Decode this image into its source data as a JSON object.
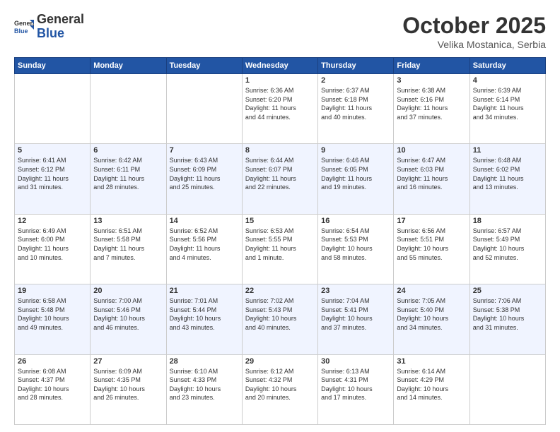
{
  "header": {
    "logo_general": "General",
    "logo_blue": "Blue",
    "month": "October 2025",
    "location": "Velika Mostanica, Serbia"
  },
  "weekdays": [
    "Sunday",
    "Monday",
    "Tuesday",
    "Wednesday",
    "Thursday",
    "Friday",
    "Saturday"
  ],
  "weeks": [
    [
      {
        "day": "",
        "info": ""
      },
      {
        "day": "",
        "info": ""
      },
      {
        "day": "",
        "info": ""
      },
      {
        "day": "1",
        "info": "Sunrise: 6:36 AM\nSunset: 6:20 PM\nDaylight: 11 hours\nand 44 minutes."
      },
      {
        "day": "2",
        "info": "Sunrise: 6:37 AM\nSunset: 6:18 PM\nDaylight: 11 hours\nand 40 minutes."
      },
      {
        "day": "3",
        "info": "Sunrise: 6:38 AM\nSunset: 6:16 PM\nDaylight: 11 hours\nand 37 minutes."
      },
      {
        "day": "4",
        "info": "Sunrise: 6:39 AM\nSunset: 6:14 PM\nDaylight: 11 hours\nand 34 minutes."
      }
    ],
    [
      {
        "day": "5",
        "info": "Sunrise: 6:41 AM\nSunset: 6:12 PM\nDaylight: 11 hours\nand 31 minutes."
      },
      {
        "day": "6",
        "info": "Sunrise: 6:42 AM\nSunset: 6:11 PM\nDaylight: 11 hours\nand 28 minutes."
      },
      {
        "day": "7",
        "info": "Sunrise: 6:43 AM\nSunset: 6:09 PM\nDaylight: 11 hours\nand 25 minutes."
      },
      {
        "day": "8",
        "info": "Sunrise: 6:44 AM\nSunset: 6:07 PM\nDaylight: 11 hours\nand 22 minutes."
      },
      {
        "day": "9",
        "info": "Sunrise: 6:46 AM\nSunset: 6:05 PM\nDaylight: 11 hours\nand 19 minutes."
      },
      {
        "day": "10",
        "info": "Sunrise: 6:47 AM\nSunset: 6:03 PM\nDaylight: 11 hours\nand 16 minutes."
      },
      {
        "day": "11",
        "info": "Sunrise: 6:48 AM\nSunset: 6:02 PM\nDaylight: 11 hours\nand 13 minutes."
      }
    ],
    [
      {
        "day": "12",
        "info": "Sunrise: 6:49 AM\nSunset: 6:00 PM\nDaylight: 11 hours\nand 10 minutes."
      },
      {
        "day": "13",
        "info": "Sunrise: 6:51 AM\nSunset: 5:58 PM\nDaylight: 11 hours\nand 7 minutes."
      },
      {
        "day": "14",
        "info": "Sunrise: 6:52 AM\nSunset: 5:56 PM\nDaylight: 11 hours\nand 4 minutes."
      },
      {
        "day": "15",
        "info": "Sunrise: 6:53 AM\nSunset: 5:55 PM\nDaylight: 11 hours\nand 1 minute."
      },
      {
        "day": "16",
        "info": "Sunrise: 6:54 AM\nSunset: 5:53 PM\nDaylight: 10 hours\nand 58 minutes."
      },
      {
        "day": "17",
        "info": "Sunrise: 6:56 AM\nSunset: 5:51 PM\nDaylight: 10 hours\nand 55 minutes."
      },
      {
        "day": "18",
        "info": "Sunrise: 6:57 AM\nSunset: 5:49 PM\nDaylight: 10 hours\nand 52 minutes."
      }
    ],
    [
      {
        "day": "19",
        "info": "Sunrise: 6:58 AM\nSunset: 5:48 PM\nDaylight: 10 hours\nand 49 minutes."
      },
      {
        "day": "20",
        "info": "Sunrise: 7:00 AM\nSunset: 5:46 PM\nDaylight: 10 hours\nand 46 minutes."
      },
      {
        "day": "21",
        "info": "Sunrise: 7:01 AM\nSunset: 5:44 PM\nDaylight: 10 hours\nand 43 minutes."
      },
      {
        "day": "22",
        "info": "Sunrise: 7:02 AM\nSunset: 5:43 PM\nDaylight: 10 hours\nand 40 minutes."
      },
      {
        "day": "23",
        "info": "Sunrise: 7:04 AM\nSunset: 5:41 PM\nDaylight: 10 hours\nand 37 minutes."
      },
      {
        "day": "24",
        "info": "Sunrise: 7:05 AM\nSunset: 5:40 PM\nDaylight: 10 hours\nand 34 minutes."
      },
      {
        "day": "25",
        "info": "Sunrise: 7:06 AM\nSunset: 5:38 PM\nDaylight: 10 hours\nand 31 minutes."
      }
    ],
    [
      {
        "day": "26",
        "info": "Sunrise: 6:08 AM\nSunset: 4:37 PM\nDaylight: 10 hours\nand 28 minutes."
      },
      {
        "day": "27",
        "info": "Sunrise: 6:09 AM\nSunset: 4:35 PM\nDaylight: 10 hours\nand 26 minutes."
      },
      {
        "day": "28",
        "info": "Sunrise: 6:10 AM\nSunset: 4:33 PM\nDaylight: 10 hours\nand 23 minutes."
      },
      {
        "day": "29",
        "info": "Sunrise: 6:12 AM\nSunset: 4:32 PM\nDaylight: 10 hours\nand 20 minutes."
      },
      {
        "day": "30",
        "info": "Sunrise: 6:13 AM\nSunset: 4:31 PM\nDaylight: 10 hours\nand 17 minutes."
      },
      {
        "day": "31",
        "info": "Sunrise: 6:14 AM\nSunset: 4:29 PM\nDaylight: 10 hours\nand 14 minutes."
      },
      {
        "day": "",
        "info": ""
      }
    ]
  ]
}
